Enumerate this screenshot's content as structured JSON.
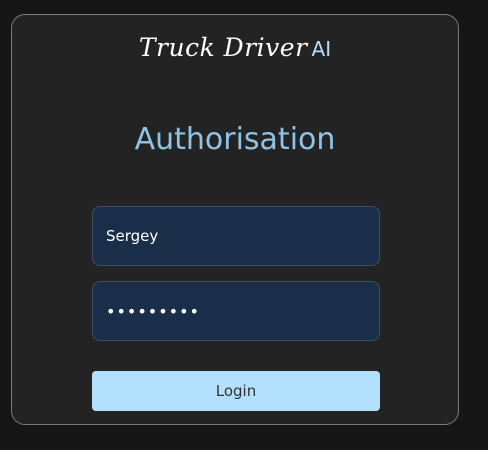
{
  "brand": {
    "script_text": "Truck Driver",
    "suffix": "AI"
  },
  "page_title": "Authorisation",
  "form": {
    "username_value": "Sergey",
    "password_value": "•••••••••",
    "login_label": "Login"
  },
  "colors": {
    "background": "#161616",
    "card": "#232323",
    "title": "#8fc3e6",
    "input_bg": "#1a2e49",
    "button_bg": "#b3e0fd"
  }
}
